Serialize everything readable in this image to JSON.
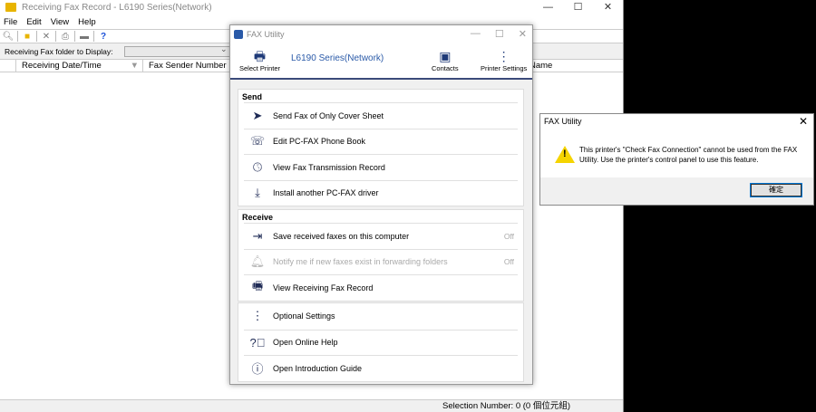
{
  "main": {
    "title": "Receiving Fax Record - L6190 Series(Network)",
    "menu": [
      "File",
      "Edit",
      "View",
      "Help"
    ],
    "folder_label": "Receiving Fax folder to Display:",
    "folder_value": "",
    "columns": [
      "Receiving Date/Time",
      "Fax Sender Number",
      "Name"
    ],
    "status": "Selection Number: 0 (0 個位元組)"
  },
  "fax": {
    "title": "FAX Utility",
    "select_printer": "Select Printer",
    "printer_name": "L6190 Series(Network)",
    "contacts": "Contacts",
    "printer_settings": "Printer Settings",
    "send_header": "Send",
    "send_items": [
      "Send Fax of Only Cover Sheet",
      "Edit PC-FAX Phone Book",
      "View Fax Transmission Record",
      "Install another PC-FAX driver"
    ],
    "receive_header": "Receive",
    "receive_items": [
      {
        "label": "Save received faxes on this computer",
        "state": "Off"
      },
      {
        "label": "Notify me if new faxes exist in forwarding folders",
        "state": "Off"
      },
      {
        "label": "View Receiving Fax Record"
      }
    ],
    "other_items": [
      "Optional Settings",
      "Open Online Help",
      "Open Introduction Guide"
    ]
  },
  "dialog": {
    "title": "FAX Utility",
    "message": "This printer's \"Check Fax Connection\" cannot be used from the FAX Utility. Use the printer's control panel to use this feature.",
    "ok": "確定"
  }
}
